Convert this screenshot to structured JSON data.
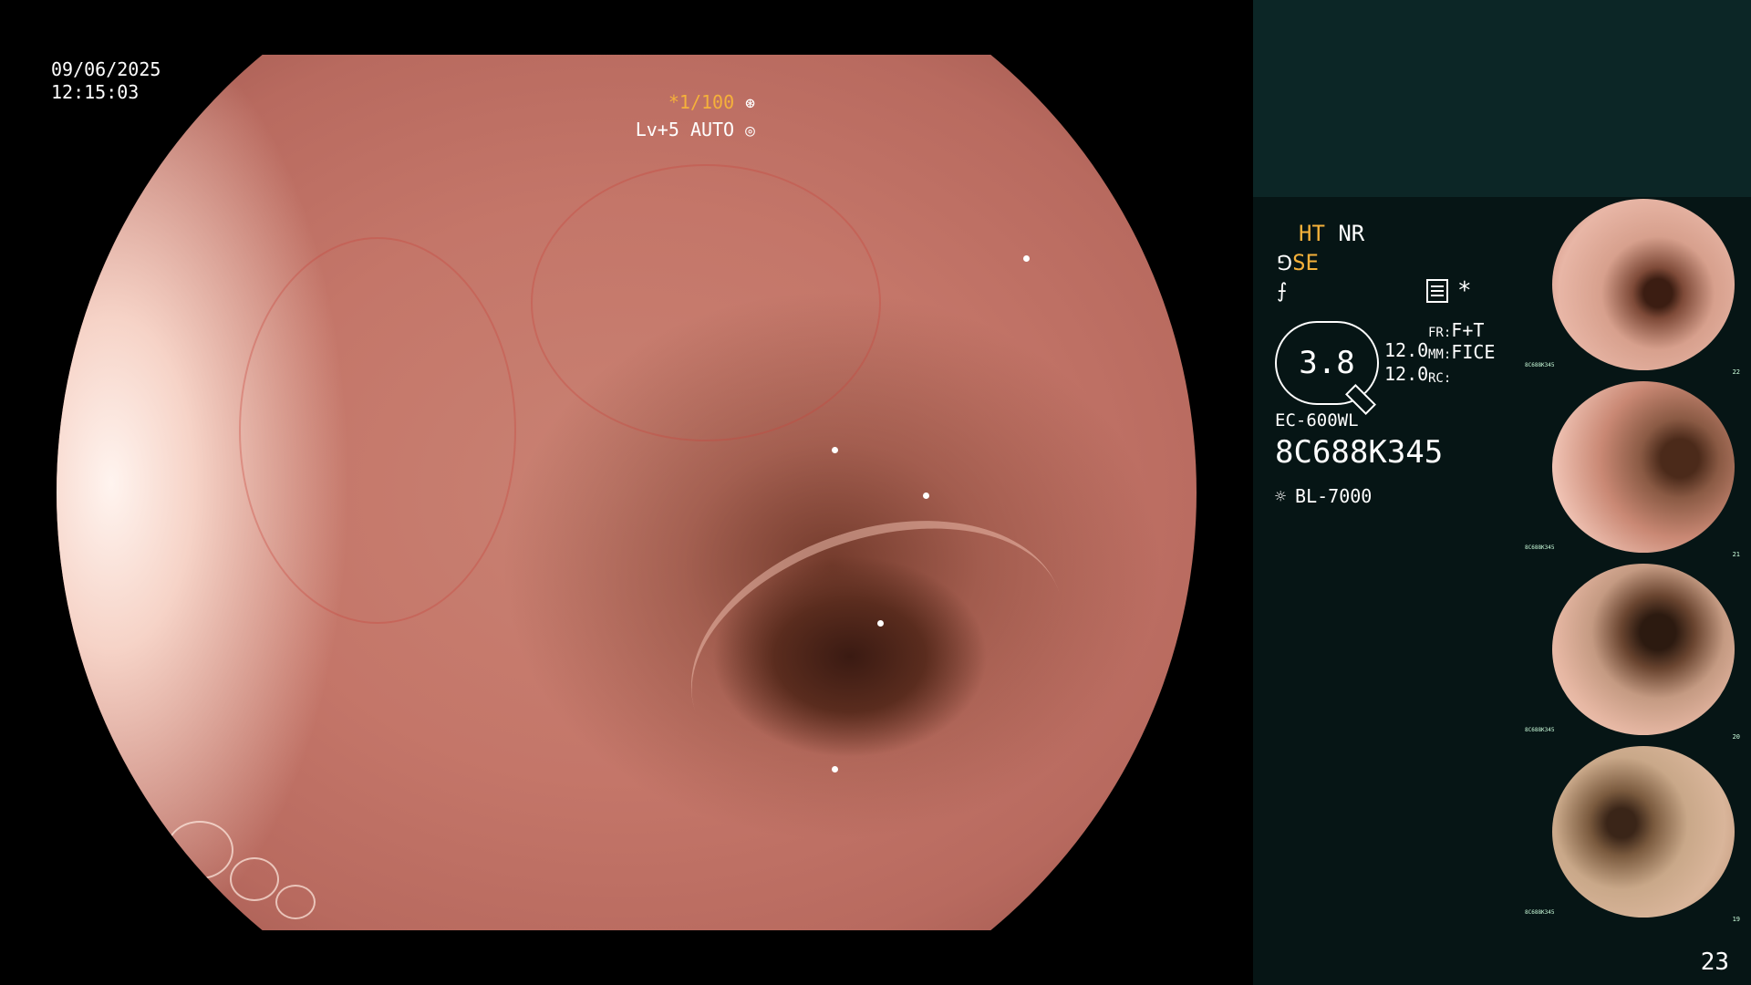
{
  "overlay": {
    "date": "09/06/2025",
    "time": "12:15:03",
    "shutter_speed": "*1/100",
    "brightness_level": "Lv+5",
    "iris_mode": "AUTO"
  },
  "panel": {
    "mode_ht": "HT",
    "mode_nr": "NR",
    "mode_se": "SE",
    "display_value": "3.8",
    "value_1": "12.0",
    "value_2": "12.0",
    "label_fr": "FR:",
    "value_fr": "F+T",
    "label_mm": "MM:",
    "value_mm": "FICE",
    "label_rc": "RC:",
    "scope_model": "EC-600WL",
    "scope_serial": "8C688K345",
    "light_source": "BL-7000",
    "page_number": "23",
    "thumbnails": [
      {
        "serial": "8C688K345",
        "index": "22"
      },
      {
        "serial": "8C688K345",
        "index": "21"
      },
      {
        "serial": "8C688K345",
        "index": "20"
      },
      {
        "serial": "8C688K345",
        "index": "19"
      }
    ]
  },
  "icons": {
    "shutter": "aperture-icon",
    "iris": "iris-icon",
    "structure": "structure-enhance-icon",
    "color": "color-enhance-icon",
    "menu": "menu-icon",
    "light": "light-source-icon"
  }
}
